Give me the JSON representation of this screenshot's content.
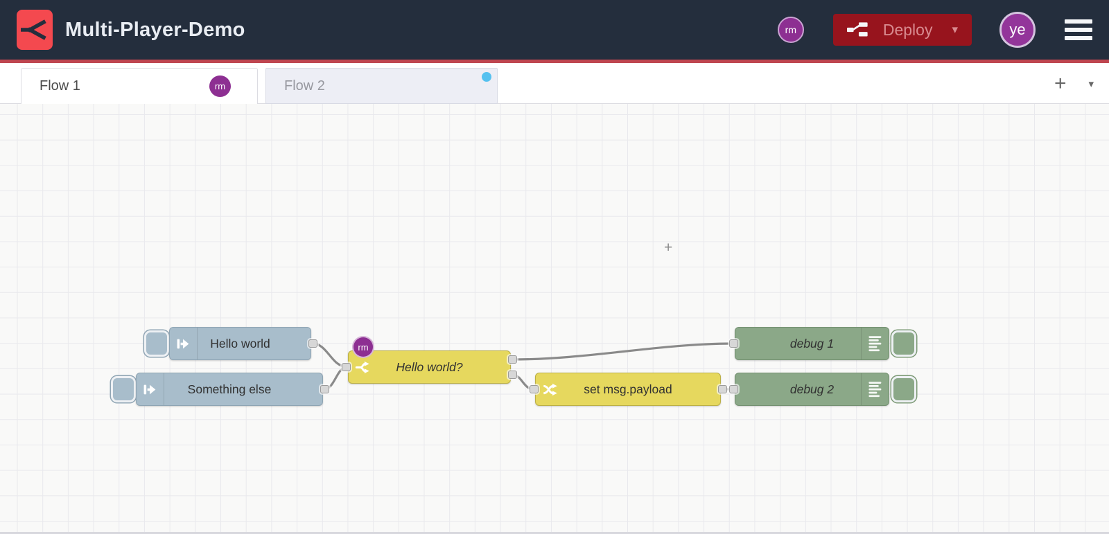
{
  "header": {
    "title": "Multi-Player-Demo",
    "presence_badge": "rm",
    "deploy": {
      "label": "Deploy",
      "caret": "▾"
    },
    "avatar": "ye"
  },
  "tabs": {
    "flow1": {
      "label": "Flow 1",
      "badge": "rm",
      "active": true
    },
    "flow2": {
      "label": "Flow 2",
      "has_activity_dot": true
    },
    "add_label": "+",
    "menu_caret": "▾"
  },
  "nodes": {
    "inject1": {
      "type": "inject",
      "label": "Hello world"
    },
    "inject2": {
      "type": "inject",
      "label": "Something else"
    },
    "switch1": {
      "type": "switch",
      "label": "Hello world?",
      "badge": "rm"
    },
    "change1": {
      "type": "change",
      "label": "set msg.payload"
    },
    "debug1": {
      "type": "debug",
      "label": "debug 1"
    },
    "debug2": {
      "type": "debug",
      "label": "debug 2"
    }
  },
  "cursor": {
    "glyph": "+"
  },
  "colors": {
    "header_bg": "#242e3d",
    "brand_red": "#f4494f",
    "deploy_red": "#97141d",
    "deploy_text": "#d98b90",
    "purple_badge": "#8d2f92",
    "avatar_purple": "#93359a",
    "red_separator": "#bf4650",
    "tab_inactive_bg": "#edeef5",
    "activity_dot_blue": "#55c1ef",
    "inject_node": "#a8bdcb",
    "function_yellow": "#e6d85e",
    "debug_green": "#8ba888",
    "wire_gray": "#8a8a8a",
    "canvas_bg": "#f9f9f8",
    "grid_line": "#e9e9ed"
  }
}
